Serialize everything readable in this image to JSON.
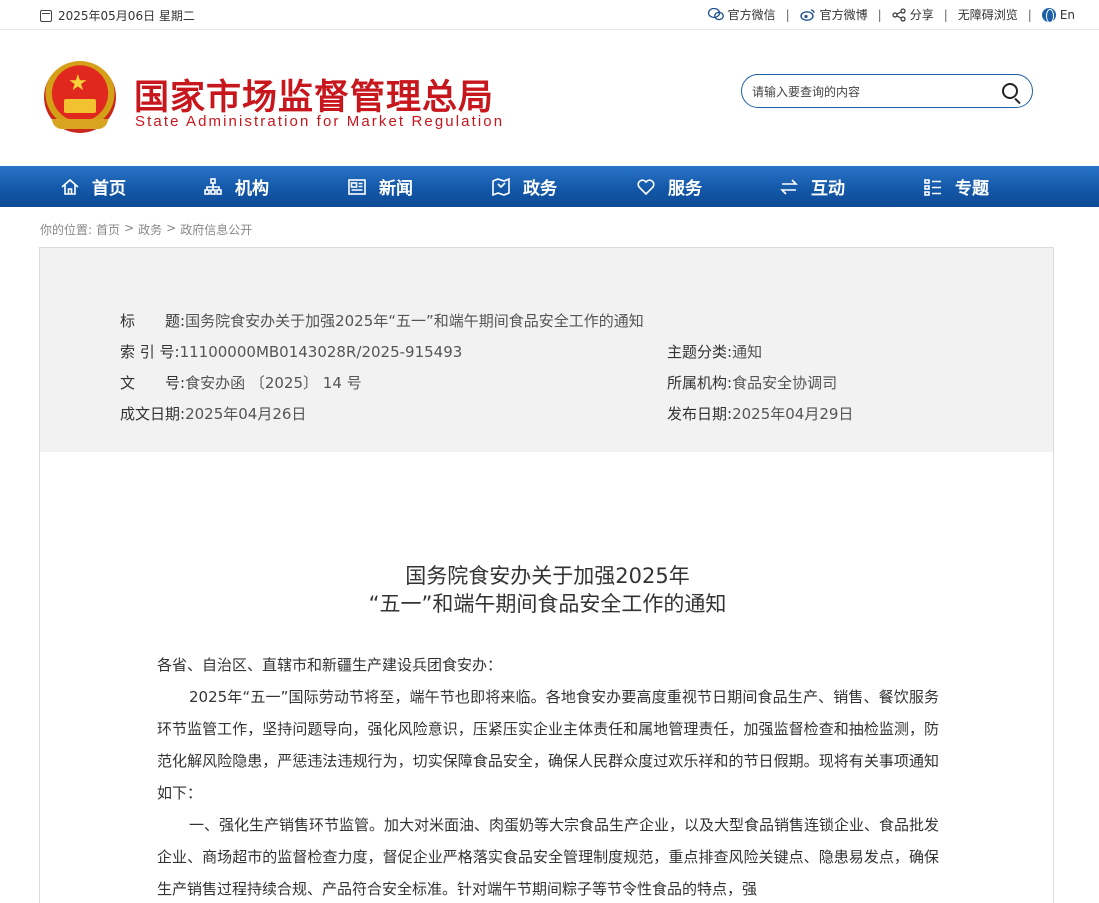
{
  "topbar": {
    "date": "2025年05月06日 星期二",
    "links": [
      {
        "icon": "wechat-icon",
        "label": "官方微信"
      },
      {
        "icon": "weibo-icon",
        "label": "官方微博"
      },
      {
        "icon": "share-icon",
        "label": "分享"
      },
      {
        "icon": "",
        "label": "无障碍浏览"
      },
      {
        "icon": "globe-icon",
        "label": "En"
      }
    ]
  },
  "header": {
    "title_cn": "国家市场监督管理总局",
    "title_en": "State Administration for Market Regulation",
    "search_placeholder": "请输入要查询的内容"
  },
  "nav": {
    "items": [
      {
        "label": "首页",
        "icon": "home-icon"
      },
      {
        "label": "机构",
        "icon": "org-icon"
      },
      {
        "label": "新闻",
        "icon": "news-icon"
      },
      {
        "label": "政务",
        "icon": "gov-icon"
      },
      {
        "label": "服务",
        "icon": "heart-icon"
      },
      {
        "label": "互动",
        "icon": "exchange-icon"
      },
      {
        "label": "专题",
        "icon": "topic-icon"
      }
    ]
  },
  "breadcrumb": {
    "prefix": "你的位置:",
    "items": [
      "首页",
      "政务",
      "政府信息公开"
    ],
    "separator": ">"
  },
  "meta": {
    "title_key": "标　　题:",
    "title_val": "国务院食安办关于加强2025年“五一”和端午期间食品安全工作的通知",
    "index_key": "索 引 号:",
    "index_val": "11100000MB0143028R/2025-915493",
    "category_key": "主题分类:",
    "category_val": "通知",
    "doc_key": "文　　号:",
    "doc_val": "食安办函 〔2025〕 14 号",
    "org_key": "所属机构:",
    "org_val": "食品安全协调司",
    "written_key": "成文日期:",
    "written_val": "2025年04月26日",
    "published_key": "发布日期:",
    "published_val": "2025年04月29日"
  },
  "article": {
    "title_line1": "国务院食安办关于加强2025年",
    "title_line2": "“五一”和端午期间食品安全工作的通知",
    "salutation": "各省、自治区、直辖市和新疆生产建设兵团食安办：",
    "para1": "2025年“五一”国际劳动节将至，端午节也即将来临。各地食安办要高度重视节日期间食品生产、销售、餐饮服务环节监管工作，坚持问题导向，强化风险意识，压紧压实企业主体责任和属地管理责任，加强监督检查和抽检监测，防范化解风险隐患，严惩违法违规行为，切实保障食品安全，确保人民群众度过欢乐祥和的节日假期。现将有关事项通知如下：",
    "para2": "一、强化生产销售环节监管。加大对米面油、肉蛋奶等大宗食品生产企业，以及大型食品销售连锁企业、食品批发企业、商场超市的监督检查力度，督促企业严格落实食品安全管理制度规范，重点排查风险关键点、隐患易发点，确保生产销售过程持续合规、产品符合安全标准。针对端午节期间粽子等节令性食品的特点，强"
  }
}
